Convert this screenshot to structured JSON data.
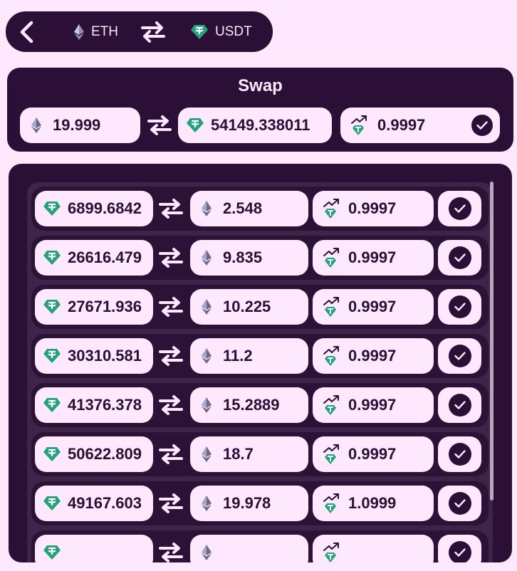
{
  "nav": {
    "from_symbol": "ETH",
    "to_symbol": "USDT",
    "from_icon": "eth-icon",
    "to_icon": "usdt-icon"
  },
  "swap": {
    "title": "Swap",
    "amount_eth": "19.999",
    "amount_usdt": "54149.338011",
    "rate": "0.9997"
  },
  "orders": [
    {
      "usdt": "6899.6842",
      "eth": "2.548",
      "rate": "0.9997"
    },
    {
      "usdt": "26616.479",
      "eth": "9.835",
      "rate": "0.9997"
    },
    {
      "usdt": "27671.936",
      "eth": "10.225",
      "rate": "0.9997"
    },
    {
      "usdt": "30310.581",
      "eth": "11.2",
      "rate": "0.9997"
    },
    {
      "usdt": "41376.378",
      "eth": "15.2889",
      "rate": "0.9997"
    },
    {
      "usdt": "50622.809",
      "eth": "18.7",
      "rate": "0.9997"
    },
    {
      "usdt": "49167.603",
      "eth": "19.978",
      "rate": "1.0999"
    },
    {
      "usdt": "",
      "eth": "",
      "rate": ""
    }
  ],
  "colors": {
    "dark": "#2b0f36",
    "light": "#fde8fd",
    "usdt": "#26a17b",
    "eth": "#6c6a8a"
  }
}
